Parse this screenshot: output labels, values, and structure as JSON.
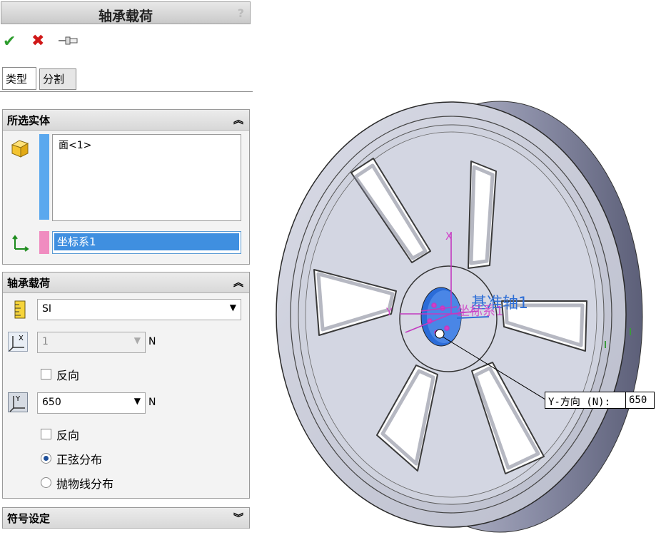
{
  "panel": {
    "title": "轴承载荷",
    "help_glyph": "?",
    "toolbar": {
      "ok_icon": "check-icon",
      "cancel_icon": "close-icon",
      "pin_icon": "pushpin-icon"
    },
    "tabs": [
      {
        "label": "类型",
        "active": true
      },
      {
        "label": "分割",
        "active": false
      }
    ]
  },
  "selected_entities": {
    "header": "所选实体",
    "faces": [
      "面<1>"
    ],
    "coordinate_system": "坐标系1",
    "faces_color": "#5aa8ee",
    "coord_color": "#f08cc0"
  },
  "bearing_load": {
    "header": "轴承载荷",
    "unit_system": "SI",
    "x_value": "1",
    "x_unit": "N",
    "x_reverse_label": "反向",
    "y_value": "650",
    "y_unit": "N",
    "y_reverse_label": "反向",
    "distribution": [
      {
        "label": "正弦分布",
        "selected": true
      },
      {
        "label": "抛物线分布",
        "selected": false
      }
    ]
  },
  "symbol_settings": {
    "header": "符号设定"
  },
  "viewport": {
    "axis_label": "基准轴1",
    "coord_label": "坐标系1",
    "y_axis_letter": "Y",
    "x_axis_letter": "X",
    "callout_label": "Y-方向 (N):",
    "callout_value": "650"
  },
  "colors": {
    "accent_blue": "#2f6fd6",
    "magenta": "#d040c8",
    "wheel": "#c8ccd8"
  }
}
